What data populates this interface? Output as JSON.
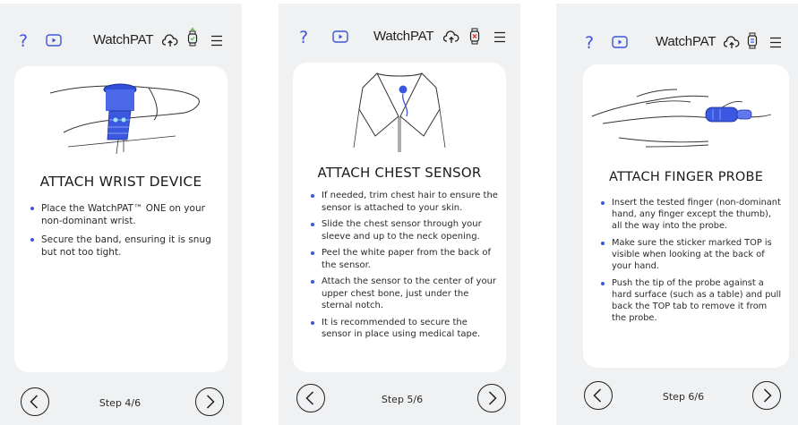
{
  "app": {
    "brand": "WatchPAT"
  },
  "screens": [
    {
      "title": "ATTACH WRIST DEVICE",
      "bullets": [
        "Place the WatchPAT™ ONE on your non-dominant wrist.",
        "Secure the band, ensuring it is snug but not too tight."
      ],
      "step": "Step 4/6"
    },
    {
      "title": "ATTACH CHEST SENSOR",
      "bullets": [
        "If needed, trim chest hair to ensure the sensor is attached to your skin.",
        "Slide the chest sensor through your sleeve and up to the neck opening.",
        "Peel the white paper from the back of the sensor.",
        "Attach the sensor to the center of your upper chest bone, just under the sternal notch.",
        "It is recommended to secure the sensor in place using medical tape."
      ],
      "step": "Step 5/6"
    },
    {
      "title": "ATTACH FINGER PROBE",
      "bullets": [
        "Insert the tested finger (non-dominant hand, any finger except the thumb), all the way into the probe.",
        "Make sure the sticker marked TOP is visible when looking at the back of your hand.",
        "Push the tip of the probe against a hard surface (such as a table) and pull back the TOP tab to remove it from the probe."
      ],
      "step": "Step 6/6"
    }
  ],
  "icons": {
    "help": "?",
    "video": "play-icon",
    "cloud": "cloud-upload-icon",
    "watch": "watch-icon",
    "menu": "hamburger-menu-icon",
    "prev": "chevron-left-circle-icon",
    "next": "chevron-right-circle-icon"
  },
  "colors": {
    "accent": "#3e55d6",
    "screen_bg": "#f0f1f2",
    "card_bg": "#ffffff",
    "watch_status_screen1": "#6cc04a",
    "watch_status_screen2": "#d93a3a",
    "watch_status_screen3": "#3e55d6"
  }
}
